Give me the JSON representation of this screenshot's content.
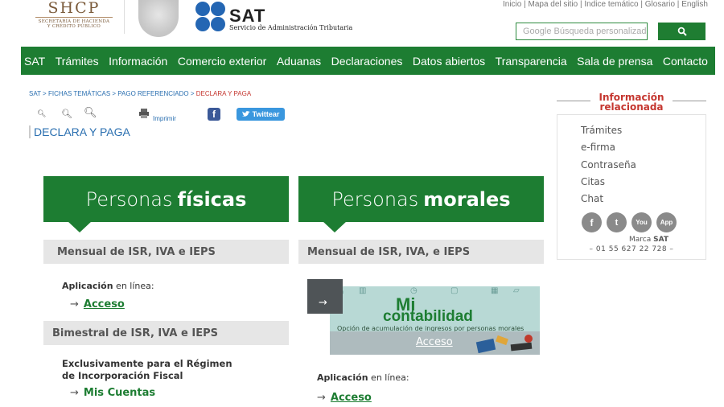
{
  "header": {
    "shcp": {
      "name": "SHCP",
      "line1": "SECRETARÍA DE HACIENDA",
      "line2": "Y CRÉDITO PÚBLICO"
    },
    "sat": {
      "name": "SAT",
      "subtitle": "Servicio de Administración Tributaria"
    },
    "top_links": [
      "Inicio",
      "Mapa del sitio",
      "Índice temático",
      "Glosario",
      "English"
    ],
    "search": {
      "placeholder": "Google Búsqueda personalizada"
    }
  },
  "nav": {
    "items": [
      "SAT",
      "Trámites",
      "Información",
      "Comercio exterior",
      "Aduanas",
      "Declaraciones",
      "Datos abiertos",
      "Transparencia",
      "Sala de prensa",
      "Contacto"
    ]
  },
  "breadcrumb": {
    "items": [
      "SAT",
      "FICHAS TEMÁTICAS",
      "PAGO REFERENCIADO"
    ],
    "current": "DECLARA Y PAGA",
    "separator": " > "
  },
  "tools": {
    "print_label": "Imprimir",
    "facebook": "f",
    "twitter": "Twittear"
  },
  "page_title": "DECLARA Y PAGA",
  "left_col": {
    "header_light": "Personas",
    "header_bold": "físicas",
    "section1": "Mensual de ISR, IVA e IEPS",
    "app_bold": "Aplicación",
    "app_rest": " en línea:",
    "access1": "Acceso",
    "section2": "Bimestral de ISR, IVA e IEPS",
    "excl_line1": "Exclusivamente para el Régimen",
    "excl_line2": "de Incorporación Fiscal",
    "access2": "Mis Cuentas"
  },
  "right_col": {
    "header_light": "Personas",
    "header_bold": "morales",
    "section1": "Mensual de ISR, IVA, e IEPS",
    "banner": {
      "mi": "Mi",
      "contabilidad": "contabilidad",
      "desc": "Opción de acumulación de ingresos por personas morales",
      "access": "Acceso"
    },
    "app_bold": "Aplicación",
    "app_rest": " en línea:",
    "access": "Acceso"
  },
  "sidebar": {
    "title_line1": "Información",
    "title_line2": "relacionada",
    "links": [
      "Trámites",
      "e-firma",
      "Contraseña",
      "Citas",
      "Chat"
    ],
    "social": [
      "f",
      "t",
      "You",
      "App"
    ],
    "marca_prefix": "Marca ",
    "marca_bold": "SAT",
    "phone": "–   01 55 627 22 728   –"
  },
  "colors": {
    "brand_green": "#1d7d32",
    "link_blue": "#2a6fb0",
    "accent_red": "#c5362f"
  }
}
